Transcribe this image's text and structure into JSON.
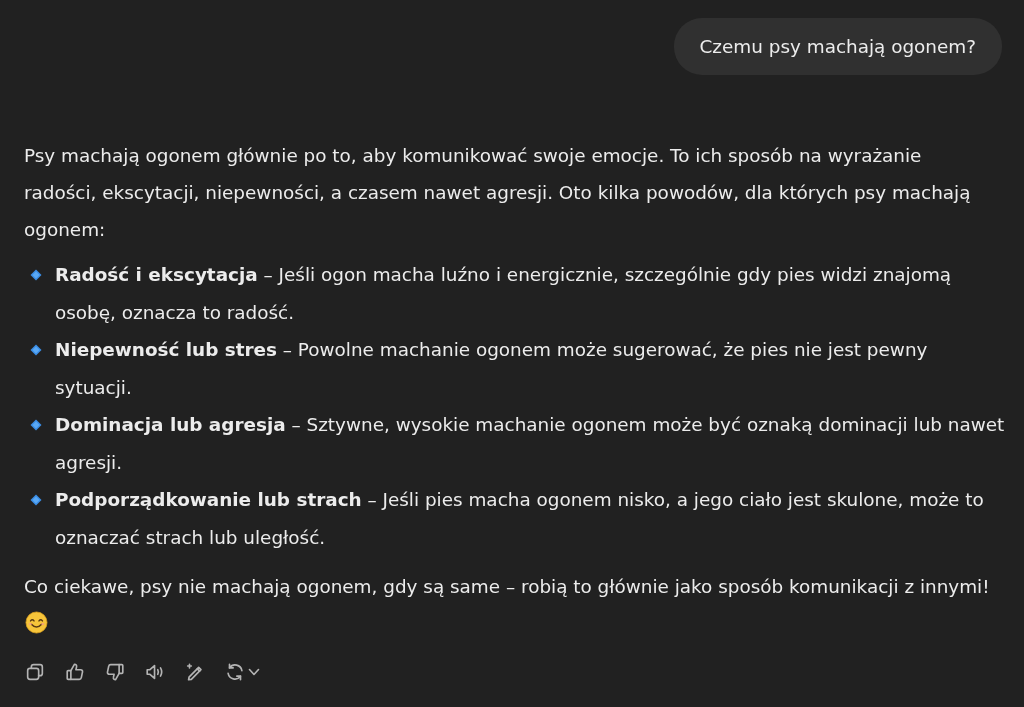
{
  "user_message": {
    "text": "Czemu psy machają ogonem?"
  },
  "response": {
    "intro": "Psy machają ogonem głównie po to, aby komunikować swoje emocje. To ich sposób na wyrażanie radości, ekscytacji, niepewności, a czasem nawet agresji. Oto kilka powodów, dla których psy machają ogonem:",
    "items": [
      {
        "text": "**Radość i ekscytacja** – Jeśli ogon macha luźno i energicznie, szczególnie gdy pies widzi znajomą osobę, oznacza to radość."
      },
      {
        "text": "**Niepewność lub stres** – Powolne machanie ogonem może sugerować, że pies nie jest pewny sytuacji."
      },
      {
        "text": "**Dominacja lub agresja** – Sztywne, wysokie machanie ogonem może być oznaką dominacji lub nawet agresji."
      },
      {
        "text": "**Podporządkowanie lub strach** – Jeśli pies macha ogonem nisko, a jego ciało jest skulone, może to oznaczać strach lub uległość."
      }
    ],
    "closing": "Co ciekawe, psy nie machają ogonem, gdy są same – robią to głównie jako sposób komunikacji z innymi!"
  }
}
